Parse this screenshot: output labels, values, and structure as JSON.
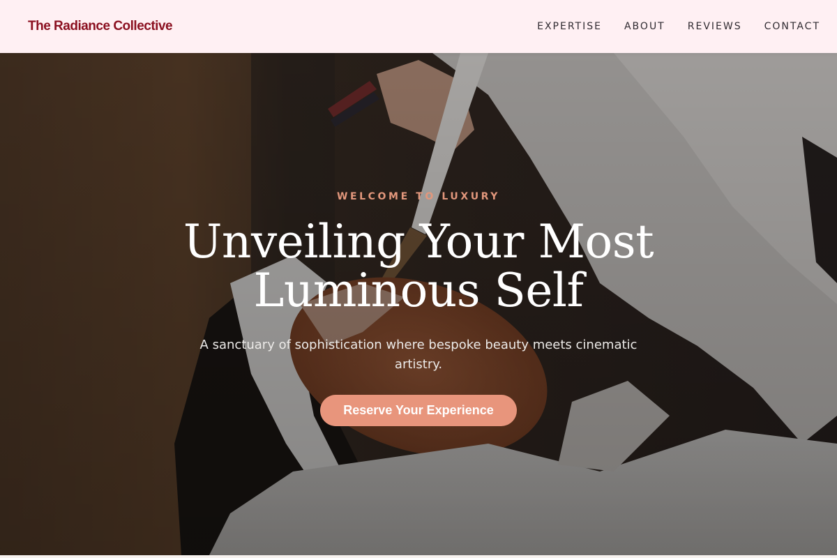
{
  "header": {
    "brand": "The Radiance Collective",
    "nav": [
      {
        "label": "EXPERTISE"
      },
      {
        "label": "ABOUT"
      },
      {
        "label": "REVIEWS"
      },
      {
        "label": "CONTACT"
      }
    ]
  },
  "hero": {
    "eyebrow": "WELCOME TO LUXURY",
    "headline": "Unveiling Your Most Luminous Self",
    "subtitle": "A sanctuary of sophistication where bespoke beauty meets cinematic artistry.",
    "cta_label": "Reserve Your Experience"
  },
  "colors": {
    "header_bg": "#fff0f3",
    "brand": "#8b1020",
    "accent": "#e8957c",
    "eyebrow": "#e2977c"
  }
}
